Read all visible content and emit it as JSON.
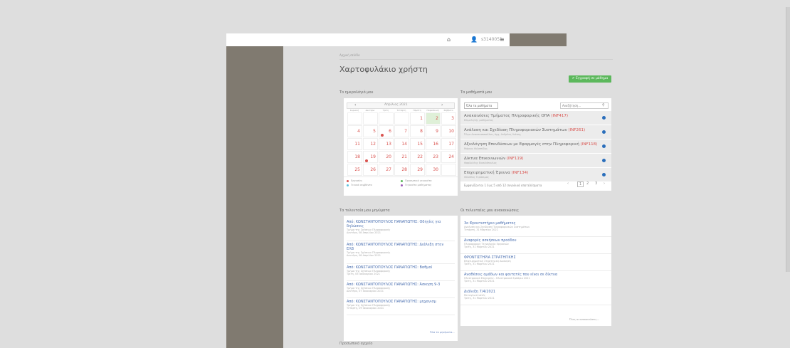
{
  "topbar": {
    "home_icon": "home-icon",
    "user_icon": "user-icon",
    "user": "s3140051",
    "settings_icon": "sliders-icon"
  },
  "breadcrumb": "Αρχική σελίδα",
  "page_title": "Χαρτοφυλάκιο χρήστη",
  "register_button": "✔ Εγγραφή σε μάθημα",
  "calendar": {
    "title": "Το ημερολόγιό μου",
    "prev": "‹",
    "next": "›",
    "month": "Απρίλιος 2021",
    "weekdays": [
      "Κυριακή",
      "Δευτέρα",
      "Τρίτη",
      "Τετάρτη",
      "Πέμπτη",
      "Παρασκευή",
      "Σάββατο"
    ],
    "weeks": [
      [
        "",
        "",
        "",
        "",
        "1",
        "2",
        "3"
      ],
      [
        "4",
        "5",
        "6",
        "7",
        "8",
        "9",
        "10"
      ],
      [
        "11",
        "12",
        "13",
        "14",
        "15",
        "16",
        "17"
      ],
      [
        "18",
        "19",
        "20",
        "21",
        "22",
        "23",
        "24"
      ],
      [
        "25",
        "26",
        "27",
        "28",
        "29",
        "30",
        ""
      ]
    ],
    "legend": [
      "Εργασίες",
      "Γενικά συμβάντα",
      "Προσωπικά γεγονότα",
      "Γεγονότα μαθήματος"
    ]
  },
  "courses": {
    "title": "Τα μαθήματά μου",
    "tab_label": "Όλα τα μαθήματα",
    "search_placeholder": "Αναζήτηση...",
    "items": [
      {
        "name": "Ανακαινίσεις Τμήματος Πληροφορικής ΟΠΑ ",
        "code": "(INF417)",
        "sub": "Επιμελητής μαθήματος"
      },
      {
        "name": "Ανάλυση και Σχεδίαση Πληροφοριακών Συστημάτων ",
        "code": "(INF261)",
        "sub": "Όλγα Αναστασοπούλου, Αρχ. Ανδρέας Λιάπης"
      },
      {
        "name": "Αξιολόγηση Επενδύσεων με Εφαρμογές στην Πληροφορική ",
        "code": "(INF118)",
        "sub": "Μάριος Φιλιππίδης"
      },
      {
        "name": "Δίκτυα Επικοινωνιών ",
        "code": "(INF119)",
        "sub": "Φαρδούλης Βασιλόπουλος"
      },
      {
        "name": "Επιχειρηματική Έρευνα ",
        "code": "(INF134)",
        "sub": "Φίλιππος Γεράσιμος"
      }
    ],
    "pager_text": "Εμφανίζονται 1 έως 5 από 12 συνολικά αποτελέσματα",
    "pages": [
      "‹",
      "1",
      "2",
      "3",
      "›"
    ]
  },
  "messages": {
    "title": "Τα τελευταία μου μηνύματα",
    "items": [
      {
        "from": "Από: ΚΩΝΣΤΑΝΤΟΠΟΥΛΟΣ ΠΑΝΑΓΙΩΤΗΣ: Οδηγίες για",
        "line2": "δηλώσεις",
        "sub1": "Τμήμα της Σχέσεων Πληροφορικής",
        "sub2": "Δευτέρα, 08 Απριλίου 2021"
      },
      {
        "from": "Από: ΚΩΝΣΤΑΝΤΟΠΟΥΛΟΣ ΠΑΝΑΓΙΩΤΗΣ: Διάλεξη στην",
        "line2": "ΕΛΒ",
        "sub1": "Τμήμα της Σχέσεων Πληροφορικής",
        "sub2": "Δευτέρα, 08 Απριλίου 2021"
      },
      {
        "from": "Από: ΚΩΝΣΤΑΝΤΟΠΟΥΛΟΣ ΠΑΝΑΓΙΩΤΗΣ: Βαθμοί",
        "line2": "",
        "sub1": "Τμήμα της Σχέσεων Πληροφορικής",
        "sub2": "Τρίτη, 05 Ιανουαρίου 2021"
      },
      {
        "from": "Από: ΚΩΝΣΤΑΝΤΟΠΟΥΛΟΣ ΠΑΝΑΓΙΩΤΗΣ: Άσκηση 9-3",
        "line2": "",
        "sub1": "Τμήμα της Σχέσεων Πληροφορικής",
        "sub2": "Δευτέρα, 07 Ιανουαρίου 2021"
      },
      {
        "from": "Από: ΚΩΝΣΤΑΝΤΟΠΟΥΛΟΣ ΠΑΝΑΓΙΩΤΗΣ: μηχανισμ",
        "line2": "",
        "sub1": "Τμήμα της Σχέσεων Πληροφορικής",
        "sub2": "Τετάρτη, 09 Ιανουαρίου 2021"
      }
    ],
    "all_link": "Όλα τα μηνύματα..."
  },
  "announcements": {
    "title": "Οι τελευταίες μου ανακοινώσεις",
    "items": [
      {
        "a": "3ο Φροντιστήριο μαθήματος",
        "sub1": "Ανάλυση και Σχεδίαση Πληροφοριακών Συστημάτων",
        "sub2": "Τετάρτη, 31 Μαρτίου 2021"
      },
      {
        "a": "Διαφορές ασκήσεων προόδου",
        "sub1": "Πληροφορική Τεχνολογία Εργασιών",
        "sub2": "Τρίτη, 31 Μαρτίου 2021"
      },
      {
        "a": "ΦΡΟΝΤΙΣΤΗΡΙΑ ΣΤΡΑΤΗΓΙΚΗΣ",
        "sub1": "Επιχειρηματική Στρατηγική Διοίκηση",
        "sub2": "Τρίτη, 31 Μαρτίου 2021"
      },
      {
        "a": "Αναθέσεις ομάδων και φοιτητές που είναι σε δίκτυα",
        "sub1": "Ηλεκτρονικό Επιχειρείν - Ηλεκτρονικό Εμπόριο 2021",
        "sub2": "Τρίτη, 31 Μαρτίου 2021"
      },
      {
        "a": "Διάλεξη 7/4/2021",
        "sub1": "Μεταγλωττιστές",
        "sub2": "Τρίτη, 31 Μαρτίου 2021"
      }
    ],
    "all_link": "Όλες οι ανακοινώσεις..."
  },
  "bottom_section": "Προσωπικό αρχείο",
  "colors": {
    "sidebar": "#807a70",
    "accent_green": "#5cb85c",
    "link": "#4a6fb0",
    "red": "#d9534f"
  }
}
